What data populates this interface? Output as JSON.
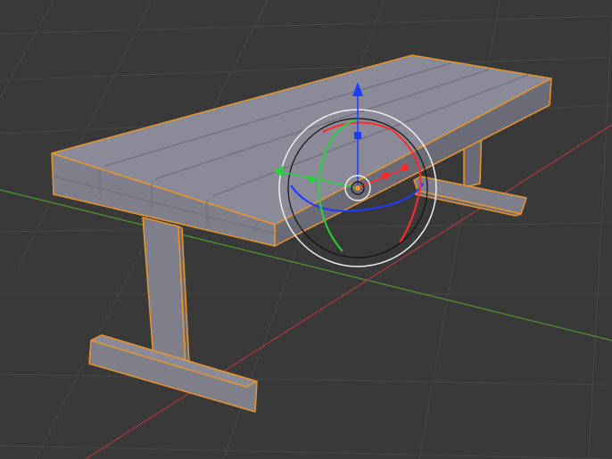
{
  "viewport": {
    "name": "3D Viewport",
    "background": "#393939",
    "grid_color": "#474747"
  },
  "axes": {
    "x_color": "#b03a3a",
    "y_color": "#4f9a2e"
  },
  "object": {
    "name": "bench",
    "selected": true,
    "body_color": "#7f7f8c",
    "top_color": "#8a8a99",
    "shade_color": "#6b6b78",
    "outline_color": "#e8962c"
  },
  "gizmo": {
    "kind": "transform",
    "x_color": "#ff2a2a",
    "y_color": "#27d33b",
    "z_color": "#1e3cff",
    "ring_color": "#f0f0f0",
    "trackball_color": "#111111",
    "pivot_color": "#e8962c"
  }
}
